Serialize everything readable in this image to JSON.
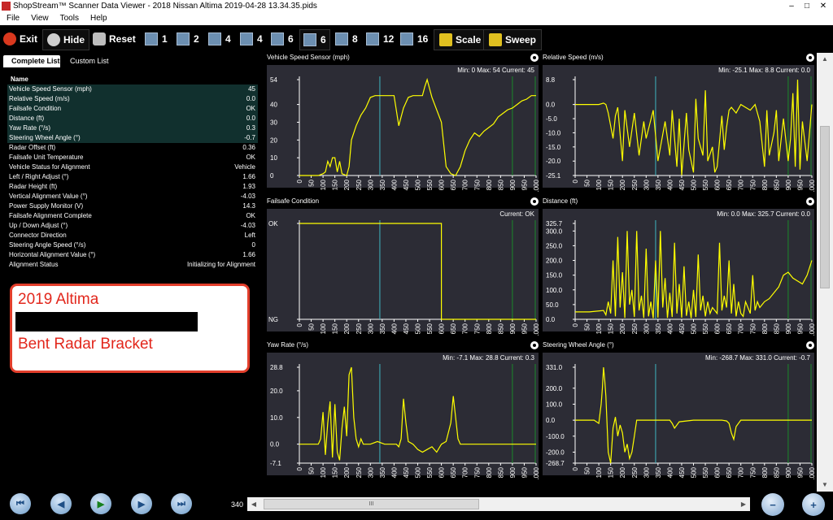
{
  "window": {
    "title": "ShopStream™ Scanner Data Viewer - 2018 Nissan Altima 2019-04-28 13.34.35.pids",
    "minimize": "–",
    "maximize": "□",
    "close": "✕"
  },
  "menu": [
    "File",
    "View",
    "Tools",
    "Help"
  ],
  "toolbar": {
    "exit": "Exit",
    "hide": "Hide",
    "reset": "Reset",
    "layouts": [
      "1",
      "2",
      "4",
      "4",
      "6",
      "6",
      "8",
      "12",
      "16"
    ],
    "scale": "Scale",
    "sweep": "Sweep"
  },
  "tabs": [
    "Complete List",
    "Custom List"
  ],
  "list": {
    "header": "Name",
    "rows": [
      {
        "name": "Vehicle Speed Sensor (mph)",
        "value": "45",
        "selected": true
      },
      {
        "name": "Relative Speed (m/s)",
        "value": "0.0",
        "selected": true
      },
      {
        "name": "Failsafe Condition",
        "value": "OK",
        "selected": true
      },
      {
        "name": "Distance (ft)",
        "value": "0.0",
        "selected": true
      },
      {
        "name": "Yaw Rate (°/s)",
        "value": "0.3",
        "selected": true
      },
      {
        "name": "Steering Wheel Angle (°)",
        "value": "-0.7",
        "selected": true
      },
      {
        "name": "Radar Offset (ft)",
        "value": "0.36",
        "selected": false
      },
      {
        "name": "Failsafe Unit Temperature",
        "value": "OK",
        "selected": false
      },
      {
        "name": "Vehicle Status for Alignment",
        "value": "Vehicle",
        "selected": false
      },
      {
        "name": "Left / Right Adjust (°)",
        "value": "1.66",
        "selected": false
      },
      {
        "name": "Radar Height (ft)",
        "value": "1.93",
        "selected": false
      },
      {
        "name": "Vertical Alignment Value (°)",
        "value": "-4.03",
        "selected": false
      },
      {
        "name": "Power Supply Monitor (V)",
        "value": "14.3",
        "selected": false
      },
      {
        "name": "Failsafe Alignment Complete",
        "value": "OK",
        "selected": false
      },
      {
        "name": "Up / Down Adjust (°)",
        "value": "-4.03",
        "selected": false
      },
      {
        "name": "Connector Direction",
        "value": "Left",
        "selected": false
      },
      {
        "name": "Steering Angle Speed (°/s)",
        "value": "0",
        "selected": false
      },
      {
        "name": "Horizontal Alignment Value (°)",
        "value": "1.66",
        "selected": false
      },
      {
        "name": "Alignment Status",
        "value": "Initializing for Alignment",
        "selected": false
      }
    ]
  },
  "callout": {
    "line1": "2019 Altima",
    "line2": "Bent Radar Bracket"
  },
  "colors": {
    "trace": "#ffff00",
    "cursor": "#3fb6c0",
    "marker": "#1a8a2a",
    "panel_bg": "#2c2c35",
    "list_selected": "#11302e",
    "callout_text": "#e2271c"
  },
  "chart_data": [
    {
      "type": "line",
      "title": "Vehicle Speed Sensor (mph)",
      "stats": "Min: 0    Max: 54    Current: 45",
      "xlim": [
        0,
        1000
      ],
      "ylim": [
        0,
        54
      ],
      "yticks": [
        0,
        10,
        20,
        30,
        40,
        54
      ],
      "cursor_x": 340,
      "markers_x": [
        900,
        1000
      ],
      "x": [
        0,
        40,
        80,
        100,
        110,
        120,
        130,
        140,
        150,
        160,
        170,
        180,
        200,
        210,
        220,
        240,
        260,
        280,
        300,
        320,
        340,
        360,
        380,
        400,
        420,
        440,
        460,
        480,
        500,
        520,
        530,
        540,
        560,
        600,
        620,
        640,
        660,
        680,
        700,
        720,
        740,
        760,
        780,
        800,
        820,
        840,
        860,
        880,
        900,
        920,
        940,
        960,
        980,
        1000
      ],
      "y": [
        0,
        0,
        0,
        1,
        2,
        8,
        5,
        10,
        10,
        2,
        8,
        1,
        0,
        5,
        20,
        28,
        34,
        38,
        44,
        45,
        45,
        45,
        45,
        45,
        28,
        38,
        44,
        45,
        45,
        45,
        50,
        54,
        44,
        30,
        5,
        1,
        0,
        5,
        14,
        20,
        24,
        22,
        25,
        27,
        29,
        33,
        35,
        37,
        38,
        40,
        42,
        43,
        45,
        45
      ]
    },
    {
      "type": "line",
      "title": "Relative Speed (m/s)",
      "stats": "Min: -25.1    Max: 8.8    Current: 0.0",
      "xlim": [
        0,
        1000
      ],
      "ylim": [
        -25.1,
        8.8
      ],
      "yticks": [
        8.8,
        0.0,
        -5.0,
        -10.0,
        -15.0,
        -20.0,
        -25.1
      ],
      "cursor_x": 340,
      "markers_x": [
        900,
        1000
      ],
      "x": [
        0,
        100,
        120,
        130,
        140,
        160,
        170,
        180,
        200,
        210,
        230,
        250,
        270,
        290,
        300,
        330,
        350,
        380,
        400,
        410,
        430,
        440,
        450,
        470,
        480,
        500,
        510,
        520,
        540,
        550,
        560,
        580,
        590,
        600,
        620,
        630,
        640,
        650,
        660,
        680,
        700,
        720,
        740,
        760,
        780,
        800,
        810,
        820,
        840,
        850,
        860,
        880,
        900,
        910,
        920,
        930,
        940,
        950,
        960,
        980,
        1000
      ],
      "y": [
        0,
        0,
        0.5,
        0,
        -3,
        -12,
        -4,
        -1,
        -20,
        -2,
        -15,
        -3,
        -18,
        -6,
        -12,
        -2,
        -20,
        -6,
        -18,
        -2,
        -22,
        -5,
        -25,
        -3,
        -16,
        -24,
        2,
        -12,
        -18,
        5,
        -20,
        -15,
        -24,
        -22,
        -4,
        -16,
        -8,
        -2,
        -1,
        -3,
        0,
        -1,
        -2,
        0,
        -6,
        -22,
        -2,
        -18,
        -10,
        -2,
        -20,
        -5,
        -20,
        -12,
        4,
        -22,
        8.8,
        -23,
        -6,
        -20,
        0
      ]
    },
    {
      "type": "line",
      "title": "Failsafe Condition",
      "stats": "Current: OK",
      "xlim": [
        0,
        1000
      ],
      "ylim": [
        0,
        1
      ],
      "ytick_labels": [
        "NG",
        "OK"
      ],
      "cursor_x": 340,
      "markers_x": [
        900,
        1000
      ],
      "x": [
        0,
        600,
        600,
        1000
      ],
      "y": [
        1,
        1,
        0,
        0
      ]
    },
    {
      "type": "line",
      "title": "Distance (ft)",
      "stats": "Min: 0.0    Max: 325.7    Current: 0.0",
      "xlim": [
        0,
        1000
      ],
      "ylim": [
        0,
        325.7
      ],
      "yticks": [
        325.7,
        300.0,
        250.0,
        200.0,
        150.0,
        100.0,
        50.0,
        0.0
      ],
      "cursor_x": 340,
      "markers_x": [
        900,
        1000
      ],
      "x": [
        0,
        60,
        120,
        130,
        140,
        150,
        160,
        170,
        180,
        190,
        200,
        210,
        220,
        230,
        240,
        250,
        260,
        270,
        280,
        290,
        300,
        310,
        320,
        330,
        340,
        350,
        360,
        370,
        380,
        390,
        400,
        410,
        420,
        430,
        440,
        450,
        460,
        470,
        480,
        490,
        500,
        510,
        520,
        530,
        540,
        550,
        560,
        570,
        580,
        590,
        600,
        610,
        620,
        630,
        640,
        650,
        660,
        670,
        680,
        690,
        700,
        710,
        720,
        730,
        740,
        750,
        760,
        770,
        780,
        790,
        800,
        820,
        840,
        860,
        880,
        900,
        920,
        940,
        960,
        980,
        1000
      ],
      "y": [
        25,
        25,
        30,
        15,
        60,
        20,
        200,
        10,
        280,
        40,
        160,
        5,
        300,
        50,
        100,
        8,
        300,
        30,
        80,
        5,
        240,
        10,
        60,
        4,
        200,
        6,
        300,
        40,
        140,
        5,
        90,
        8,
        260,
        20,
        120,
        6,
        180,
        12,
        60,
        4,
        100,
        8,
        220,
        30,
        80,
        10,
        60,
        20,
        40,
        30,
        20,
        260,
        30,
        80,
        40,
        200,
        20,
        120,
        10,
        60,
        20,
        10,
        60,
        40,
        20,
        150,
        30,
        60,
        40,
        50,
        60,
        70,
        90,
        110,
        150,
        160,
        140,
        130,
        120,
        150,
        200
      ]
    },
    {
      "type": "line",
      "title": "Yaw Rate (°/s)",
      "stats": "Min: -7.1    Max: 28.8    Current: 0.3",
      "xlim": [
        0,
        1000
      ],
      "ylim": [
        -7.1,
        28.8
      ],
      "yticks": [
        28.8,
        20.0,
        10.0,
        0.0,
        -7.1
      ],
      "cursor_x": 340,
      "markers_x": [
        900,
        1000
      ],
      "x": [
        0,
        80,
        90,
        100,
        110,
        120,
        130,
        140,
        150,
        160,
        170,
        180,
        190,
        200,
        210,
        220,
        230,
        240,
        250,
        260,
        270,
        300,
        330,
        360,
        380,
        400,
        410,
        420,
        430,
        440,
        450,
        460,
        480,
        500,
        520,
        540,
        560,
        580,
        600,
        620,
        640,
        650,
        660,
        670,
        680,
        700,
        720,
        740,
        760,
        780,
        800,
        820,
        840,
        860,
        880,
        900,
        920,
        940,
        960,
        980,
        1000
      ],
      "y": [
        0,
        0,
        2,
        12,
        -4,
        8,
        16,
        -5,
        15,
        -3,
        -6,
        6,
        14,
        3,
        26,
        28.8,
        10,
        2,
        -1,
        2,
        0,
        0,
        1,
        0,
        0,
        0,
        0,
        -1,
        2,
        17,
        8,
        1,
        0,
        -2,
        -3,
        -2,
        -1,
        -3,
        0,
        1,
        8,
        18,
        10,
        2,
        0,
        0,
        0,
        0,
        0,
        0,
        0,
        0,
        0,
        0,
        0,
        0,
        0,
        0,
        0,
        0,
        0
      ]
    },
    {
      "type": "line",
      "title": "Steering Wheel Angle (°)",
      "stats": "Min: -268.7    Max: 331.0    Current: -0.7",
      "xlim": [
        0,
        1000
      ],
      "ylim": [
        -268.7,
        331.0
      ],
      "yticks": [
        331.0,
        200.0,
        100.0,
        0.0,
        -100.0,
        -200.0,
        -268.7
      ],
      "cursor_x": 340,
      "markers_x": [
        900,
        1000
      ],
      "x": [
        0,
        80,
        100,
        110,
        115,
        120,
        125,
        130,
        140,
        150,
        160,
        170,
        180,
        190,
        200,
        210,
        220,
        230,
        240,
        250,
        260,
        300,
        340,
        360,
        380,
        400,
        410,
        420,
        440,
        500,
        520,
        540,
        560,
        580,
        600,
        620,
        640,
        650,
        660,
        670,
        680,
        700,
        720,
        760,
        800,
        840,
        880,
        920,
        960,
        1000
      ],
      "y": [
        0,
        0,
        -20,
        100,
        200,
        331,
        250,
        150,
        -200,
        -268.7,
        -50,
        20,
        -100,
        -30,
        -80,
        -200,
        -150,
        -240,
        -200,
        -100,
        0,
        0,
        0,
        0,
        0,
        0,
        -20,
        -50,
        -10,
        0,
        0,
        0,
        0,
        0,
        0,
        0,
        -5,
        -20,
        -80,
        -120,
        -40,
        0,
        0,
        0,
        0,
        0,
        0,
        0,
        0,
        0
      ]
    }
  ],
  "nav": {
    "first": "⏮",
    "prev": "◀",
    "play": "▶",
    "next": "▶",
    "last": "⏭",
    "frame": "340",
    "scroll_mark": "III",
    "zoom_out": "−",
    "zoom_in": "+"
  }
}
